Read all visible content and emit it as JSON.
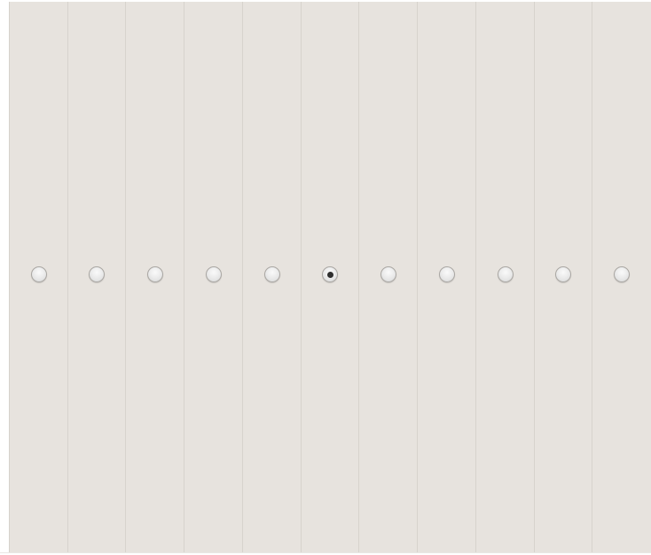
{
  "radio_group": {
    "options": [
      {
        "id": 1,
        "checked": false
      },
      {
        "id": 2,
        "checked": false
      },
      {
        "id": 3,
        "checked": false
      },
      {
        "id": 4,
        "checked": false
      },
      {
        "id": 5,
        "checked": false
      },
      {
        "id": 6,
        "checked": true
      },
      {
        "id": 7,
        "checked": false
      },
      {
        "id": 8,
        "checked": false
      },
      {
        "id": 9,
        "checked": false
      },
      {
        "id": 10,
        "checked": false
      },
      {
        "id": 11,
        "checked": false
      }
    ],
    "selected_index": 6
  },
  "colors": {
    "panel_background": "#e7e3de",
    "column_divider": "#d7d3cd",
    "radio_dot": "#2f2f2f"
  }
}
